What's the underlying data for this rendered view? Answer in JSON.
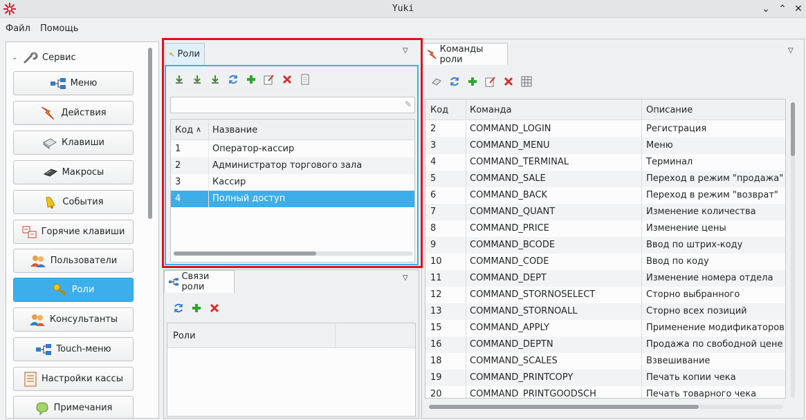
{
  "window": {
    "title": "Yuki"
  },
  "menubar": {
    "items": [
      "Файл",
      "Помощь"
    ]
  },
  "sidebar": {
    "section_label": "Сервис",
    "buttons": [
      {
        "label": "Меню",
        "icon": "menu-tree-icon"
      },
      {
        "label": "Действия",
        "icon": "actions-icon"
      },
      {
        "label": "Клавиши",
        "icon": "keyboard-icon"
      },
      {
        "label": "Макросы",
        "icon": "macros-icon"
      },
      {
        "label": "События",
        "icon": "bell-icon"
      },
      {
        "label": "Горячие клавиши",
        "icon": "hotkeys-icon"
      },
      {
        "label": "Пользователи",
        "icon": "users-icon"
      },
      {
        "label": "Роли",
        "icon": "key-icon",
        "active": true
      },
      {
        "label": "Консультанты",
        "icon": "consultants-icon"
      },
      {
        "label": "Touch-меню",
        "icon": "touch-menu-icon"
      },
      {
        "label": "Настройки кассы",
        "icon": "settings-icon"
      },
      {
        "label": "Примечания",
        "icon": "notes-icon"
      }
    ]
  },
  "roles_panel": {
    "tab_label": "Роли",
    "toolbar": [
      "download-icon",
      "download-all-icon",
      "import-icon",
      "refresh-icon",
      "add-icon",
      "edit-icon",
      "delete-icon",
      "copy-icon"
    ],
    "search": {
      "value": "",
      "placeholder": ""
    },
    "columns": [
      "Код",
      "Название"
    ],
    "rows": [
      {
        "code": "1",
        "name": "Оператор-кассир"
      },
      {
        "code": "2",
        "name": "Администратор торгового зала"
      },
      {
        "code": "3",
        "name": "Кассир"
      },
      {
        "code": "4",
        "name": "Полный доступ"
      }
    ],
    "selected_code": "4"
  },
  "links_panel": {
    "tab_label": "Связи роли",
    "toolbar": [
      "refresh-icon",
      "add-icon",
      "delete-icon"
    ],
    "columns": [
      "Роли"
    ]
  },
  "commands_panel": {
    "tab_label": "Команды роли",
    "toolbar": [
      "eraser-icon",
      "refresh-icon",
      "add-icon",
      "edit-icon",
      "delete-icon",
      "grid-icon"
    ],
    "columns": [
      "Код",
      "Команда",
      "Описание"
    ],
    "rows": [
      {
        "code": "2",
        "command": "COMMAND_LOGIN",
        "description": "Регистрация"
      },
      {
        "code": "3",
        "command": "COMMAND_MENU",
        "description": "Меню"
      },
      {
        "code": "4",
        "command": "COMMAND_TERMINAL",
        "description": "Терминал"
      },
      {
        "code": "5",
        "command": "COMMAND_SALE",
        "description": "Переход в режим \"продажа\""
      },
      {
        "code": "6",
        "command": "COMMAND_BACK",
        "description": "Переход в режим \"возврат\""
      },
      {
        "code": "7",
        "command": "COMMAND_QUANT",
        "description": "Изменение количества"
      },
      {
        "code": "8",
        "command": "COMMAND_PRICE",
        "description": "Изменение цены"
      },
      {
        "code": "9",
        "command": "COMMAND_BCODE",
        "description": "Ввод по штрих-коду"
      },
      {
        "code": "10",
        "command": "COMMAND_CODE",
        "description": "Ввод по коду"
      },
      {
        "code": "11",
        "command": "COMMAND_DEPT",
        "description": "Изменение номера отдела"
      },
      {
        "code": "12",
        "command": "COMMAND_STORNOSELECT",
        "description": "Сторно выбранного"
      },
      {
        "code": "13",
        "command": "COMMAND_STORNOALL",
        "description": "Сторно всех позиций"
      },
      {
        "code": "15",
        "command": "COMMAND_APPLY",
        "description": "Применение модификаторов"
      },
      {
        "code": "16",
        "command": "COMMAND_DEPTN",
        "description": "Продажа по свободной цене"
      },
      {
        "code": "18",
        "command": "COMMAND_SCALES",
        "description": "Взвешивание"
      },
      {
        "code": "19",
        "command": "COMMAND_PRINTCOPY",
        "description": "Печать копии чека"
      },
      {
        "code": "20",
        "command": "COMMAND_PRINTGOODSCH",
        "description": "Печать товарного чека"
      }
    ]
  },
  "colors": {
    "accent": "#3daee9",
    "highlight_frame": "#e20f1a"
  }
}
